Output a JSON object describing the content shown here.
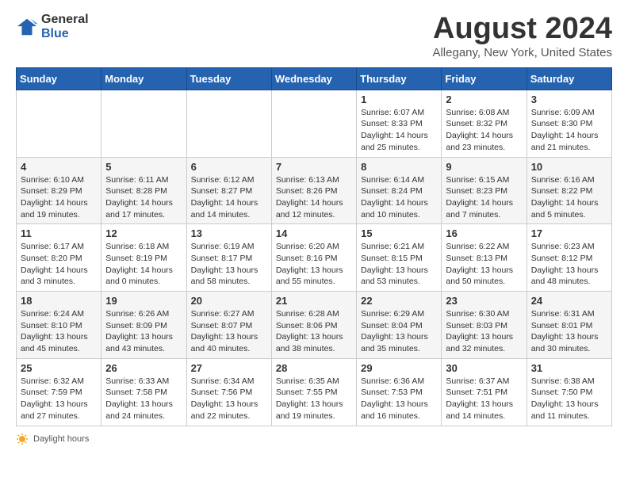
{
  "logo": {
    "general": "General",
    "blue": "Blue"
  },
  "title": "August 2024",
  "subtitle": "Allegany, New York, United States",
  "weekdays": [
    "Sunday",
    "Monday",
    "Tuesday",
    "Wednesday",
    "Thursday",
    "Friday",
    "Saturday"
  ],
  "weeks": [
    [
      {
        "day": "",
        "sunrise": "",
        "sunset": "",
        "daylight": ""
      },
      {
        "day": "",
        "sunrise": "",
        "sunset": "",
        "daylight": ""
      },
      {
        "day": "",
        "sunrise": "",
        "sunset": "",
        "daylight": ""
      },
      {
        "day": "",
        "sunrise": "",
        "sunset": "",
        "daylight": ""
      },
      {
        "day": "1",
        "sunrise": "Sunrise: 6:07 AM",
        "sunset": "Sunset: 8:33 PM",
        "daylight": "Daylight: 14 hours and 25 minutes."
      },
      {
        "day": "2",
        "sunrise": "Sunrise: 6:08 AM",
        "sunset": "Sunset: 8:32 PM",
        "daylight": "Daylight: 14 hours and 23 minutes."
      },
      {
        "day": "3",
        "sunrise": "Sunrise: 6:09 AM",
        "sunset": "Sunset: 8:30 PM",
        "daylight": "Daylight: 14 hours and 21 minutes."
      }
    ],
    [
      {
        "day": "4",
        "sunrise": "Sunrise: 6:10 AM",
        "sunset": "Sunset: 8:29 PM",
        "daylight": "Daylight: 14 hours and 19 minutes."
      },
      {
        "day": "5",
        "sunrise": "Sunrise: 6:11 AM",
        "sunset": "Sunset: 8:28 PM",
        "daylight": "Daylight: 14 hours and 17 minutes."
      },
      {
        "day": "6",
        "sunrise": "Sunrise: 6:12 AM",
        "sunset": "Sunset: 8:27 PM",
        "daylight": "Daylight: 14 hours and 14 minutes."
      },
      {
        "day": "7",
        "sunrise": "Sunrise: 6:13 AM",
        "sunset": "Sunset: 8:26 PM",
        "daylight": "Daylight: 14 hours and 12 minutes."
      },
      {
        "day": "8",
        "sunrise": "Sunrise: 6:14 AM",
        "sunset": "Sunset: 8:24 PM",
        "daylight": "Daylight: 14 hours and 10 minutes."
      },
      {
        "day": "9",
        "sunrise": "Sunrise: 6:15 AM",
        "sunset": "Sunset: 8:23 PM",
        "daylight": "Daylight: 14 hours and 7 minutes."
      },
      {
        "day": "10",
        "sunrise": "Sunrise: 6:16 AM",
        "sunset": "Sunset: 8:22 PM",
        "daylight": "Daylight: 14 hours and 5 minutes."
      }
    ],
    [
      {
        "day": "11",
        "sunrise": "Sunrise: 6:17 AM",
        "sunset": "Sunset: 8:20 PM",
        "daylight": "Daylight: 14 hours and 3 minutes."
      },
      {
        "day": "12",
        "sunrise": "Sunrise: 6:18 AM",
        "sunset": "Sunset: 8:19 PM",
        "daylight": "Daylight: 14 hours and 0 minutes."
      },
      {
        "day": "13",
        "sunrise": "Sunrise: 6:19 AM",
        "sunset": "Sunset: 8:17 PM",
        "daylight": "Daylight: 13 hours and 58 minutes."
      },
      {
        "day": "14",
        "sunrise": "Sunrise: 6:20 AM",
        "sunset": "Sunset: 8:16 PM",
        "daylight": "Daylight: 13 hours and 55 minutes."
      },
      {
        "day": "15",
        "sunrise": "Sunrise: 6:21 AM",
        "sunset": "Sunset: 8:15 PM",
        "daylight": "Daylight: 13 hours and 53 minutes."
      },
      {
        "day": "16",
        "sunrise": "Sunrise: 6:22 AM",
        "sunset": "Sunset: 8:13 PM",
        "daylight": "Daylight: 13 hours and 50 minutes."
      },
      {
        "day": "17",
        "sunrise": "Sunrise: 6:23 AM",
        "sunset": "Sunset: 8:12 PM",
        "daylight": "Daylight: 13 hours and 48 minutes."
      }
    ],
    [
      {
        "day": "18",
        "sunrise": "Sunrise: 6:24 AM",
        "sunset": "Sunset: 8:10 PM",
        "daylight": "Daylight: 13 hours and 45 minutes."
      },
      {
        "day": "19",
        "sunrise": "Sunrise: 6:26 AM",
        "sunset": "Sunset: 8:09 PM",
        "daylight": "Daylight: 13 hours and 43 minutes."
      },
      {
        "day": "20",
        "sunrise": "Sunrise: 6:27 AM",
        "sunset": "Sunset: 8:07 PM",
        "daylight": "Daylight: 13 hours and 40 minutes."
      },
      {
        "day": "21",
        "sunrise": "Sunrise: 6:28 AM",
        "sunset": "Sunset: 8:06 PM",
        "daylight": "Daylight: 13 hours and 38 minutes."
      },
      {
        "day": "22",
        "sunrise": "Sunrise: 6:29 AM",
        "sunset": "Sunset: 8:04 PM",
        "daylight": "Daylight: 13 hours and 35 minutes."
      },
      {
        "day": "23",
        "sunrise": "Sunrise: 6:30 AM",
        "sunset": "Sunset: 8:03 PM",
        "daylight": "Daylight: 13 hours and 32 minutes."
      },
      {
        "day": "24",
        "sunrise": "Sunrise: 6:31 AM",
        "sunset": "Sunset: 8:01 PM",
        "daylight": "Daylight: 13 hours and 30 minutes."
      }
    ],
    [
      {
        "day": "25",
        "sunrise": "Sunrise: 6:32 AM",
        "sunset": "Sunset: 7:59 PM",
        "daylight": "Daylight: 13 hours and 27 minutes."
      },
      {
        "day": "26",
        "sunrise": "Sunrise: 6:33 AM",
        "sunset": "Sunset: 7:58 PM",
        "daylight": "Daylight: 13 hours and 24 minutes."
      },
      {
        "day": "27",
        "sunrise": "Sunrise: 6:34 AM",
        "sunset": "Sunset: 7:56 PM",
        "daylight": "Daylight: 13 hours and 22 minutes."
      },
      {
        "day": "28",
        "sunrise": "Sunrise: 6:35 AM",
        "sunset": "Sunset: 7:55 PM",
        "daylight": "Daylight: 13 hours and 19 minutes."
      },
      {
        "day": "29",
        "sunrise": "Sunrise: 6:36 AM",
        "sunset": "Sunset: 7:53 PM",
        "daylight": "Daylight: 13 hours and 16 minutes."
      },
      {
        "day": "30",
        "sunrise": "Sunrise: 6:37 AM",
        "sunset": "Sunset: 7:51 PM",
        "daylight": "Daylight: 13 hours and 14 minutes."
      },
      {
        "day": "31",
        "sunrise": "Sunrise: 6:38 AM",
        "sunset": "Sunset: 7:50 PM",
        "daylight": "Daylight: 13 hours and 11 minutes."
      }
    ]
  ],
  "footer": {
    "label": "Daylight hours"
  }
}
